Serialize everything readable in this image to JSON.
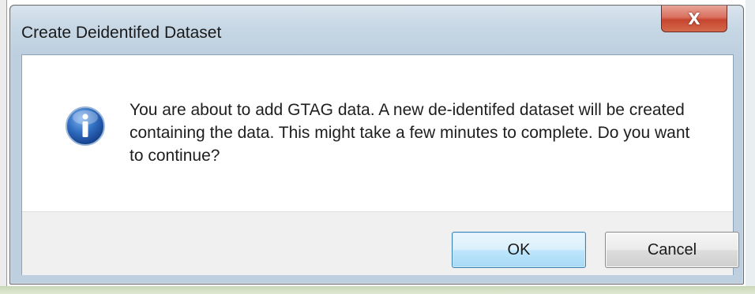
{
  "dialog": {
    "title": "Create Deidentifed Dataset",
    "close_glyph": "X",
    "icon": "information-icon",
    "message": "You are about to add GTAG data. A new de-identifed dataset will be created containing the data. This might take a few minutes to complete. Do you want to continue?",
    "buttons": {
      "ok_label": "OK",
      "cancel_label": "Cancel"
    },
    "colors": {
      "close_button": "#c7452f",
      "ok_border": "#3c7fb1",
      "info_icon": "#2c64b4"
    }
  }
}
